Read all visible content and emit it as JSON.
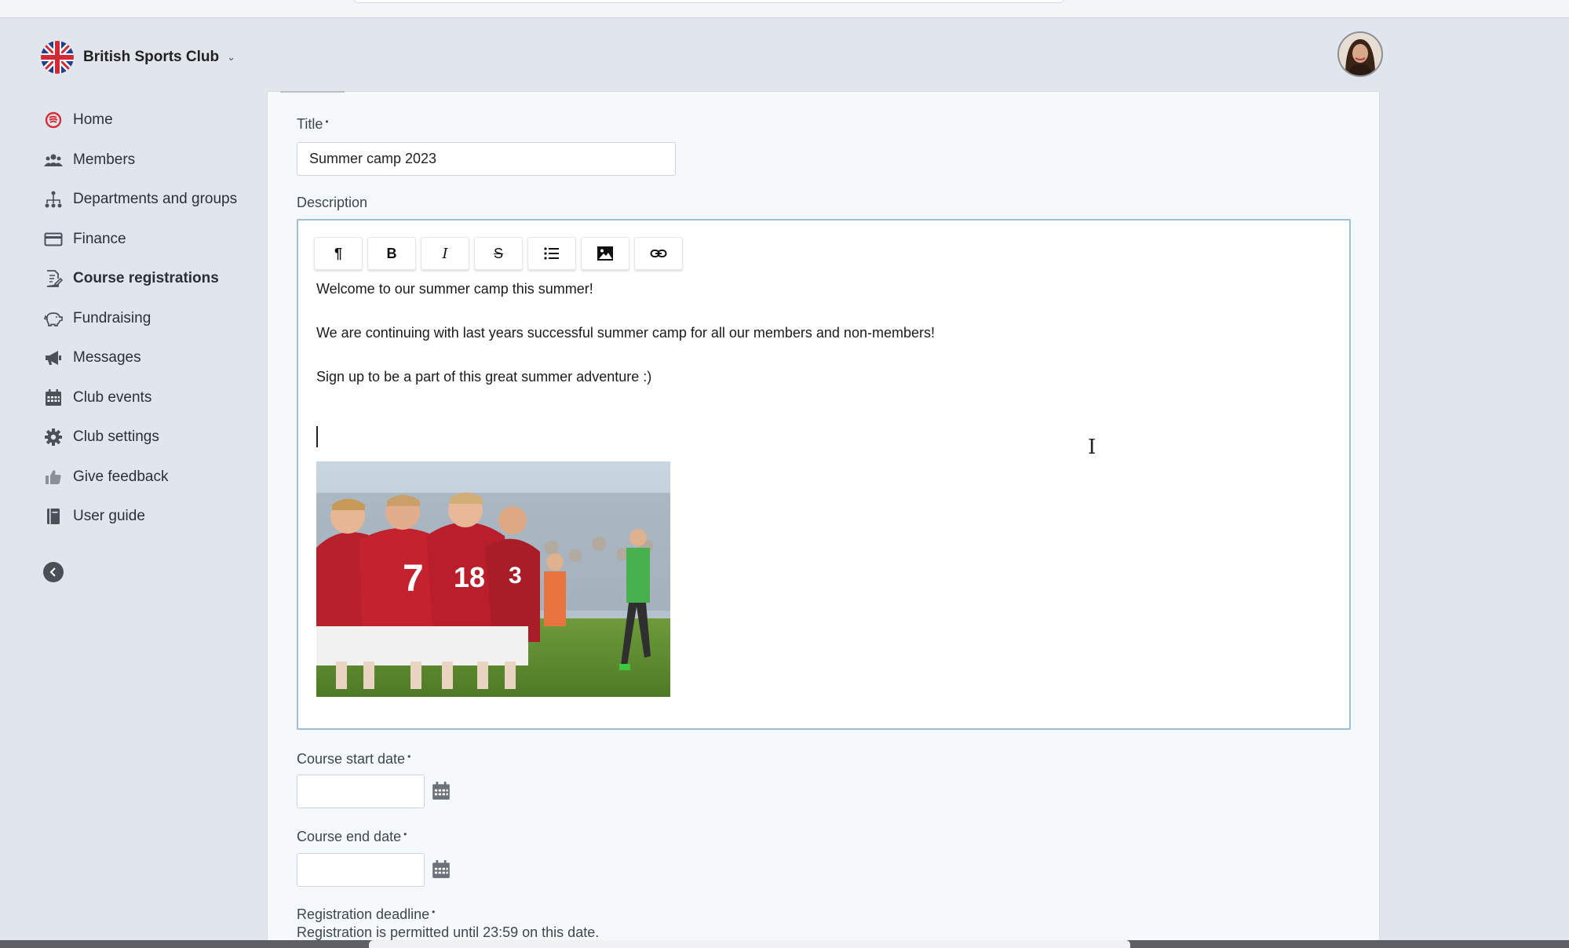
{
  "club": {
    "name": "British Sports Club",
    "chevron": "⌄"
  },
  "sidebar": {
    "items": [
      {
        "label": "Home",
        "icon": "home-logo-icon"
      },
      {
        "label": "Members",
        "icon": "members-icon"
      },
      {
        "label": "Departments and groups",
        "icon": "hierarchy-icon"
      },
      {
        "label": "Finance",
        "icon": "credit-card-icon"
      },
      {
        "label": "Course registrations",
        "icon": "document-edit-icon",
        "active": true
      },
      {
        "label": "Fundraising",
        "icon": "piggy-bank-icon"
      },
      {
        "label": "Messages",
        "icon": "megaphone-icon"
      },
      {
        "label": "Club events",
        "icon": "calendar-icon"
      },
      {
        "label": "Club settings",
        "icon": "gear-icon"
      },
      {
        "label": "Give feedback",
        "icon": "thumbs-up-icon"
      },
      {
        "label": "User guide",
        "icon": "book-icon"
      }
    ]
  },
  "form": {
    "title_label": "Title",
    "required_mark": "•",
    "title_value": "Summer camp 2023",
    "description_label": "Description",
    "toolbar": {
      "paragraph": "¶",
      "bold": "B",
      "italic": "I",
      "strike": "S"
    },
    "description_paragraphs": [
      "Welcome to our summer camp this summer!",
      "We are continuing with last years successful summer camp for all our members and non-members!",
      "Sign up to be a part of this great summer adventure :)"
    ],
    "start_date_label": "Course start date",
    "end_date_label": "Course end date",
    "deadline_label": "Registration deadline",
    "deadline_help": "Registration is permitted until 23:59 on this date.",
    "cursor_glyph": "I"
  },
  "colors": {
    "accent_red": "#d62d3a",
    "editor_border": "#9dbdd9",
    "panel_bg": "#f6f9fc",
    "page_bg": "#e1e6ed"
  }
}
